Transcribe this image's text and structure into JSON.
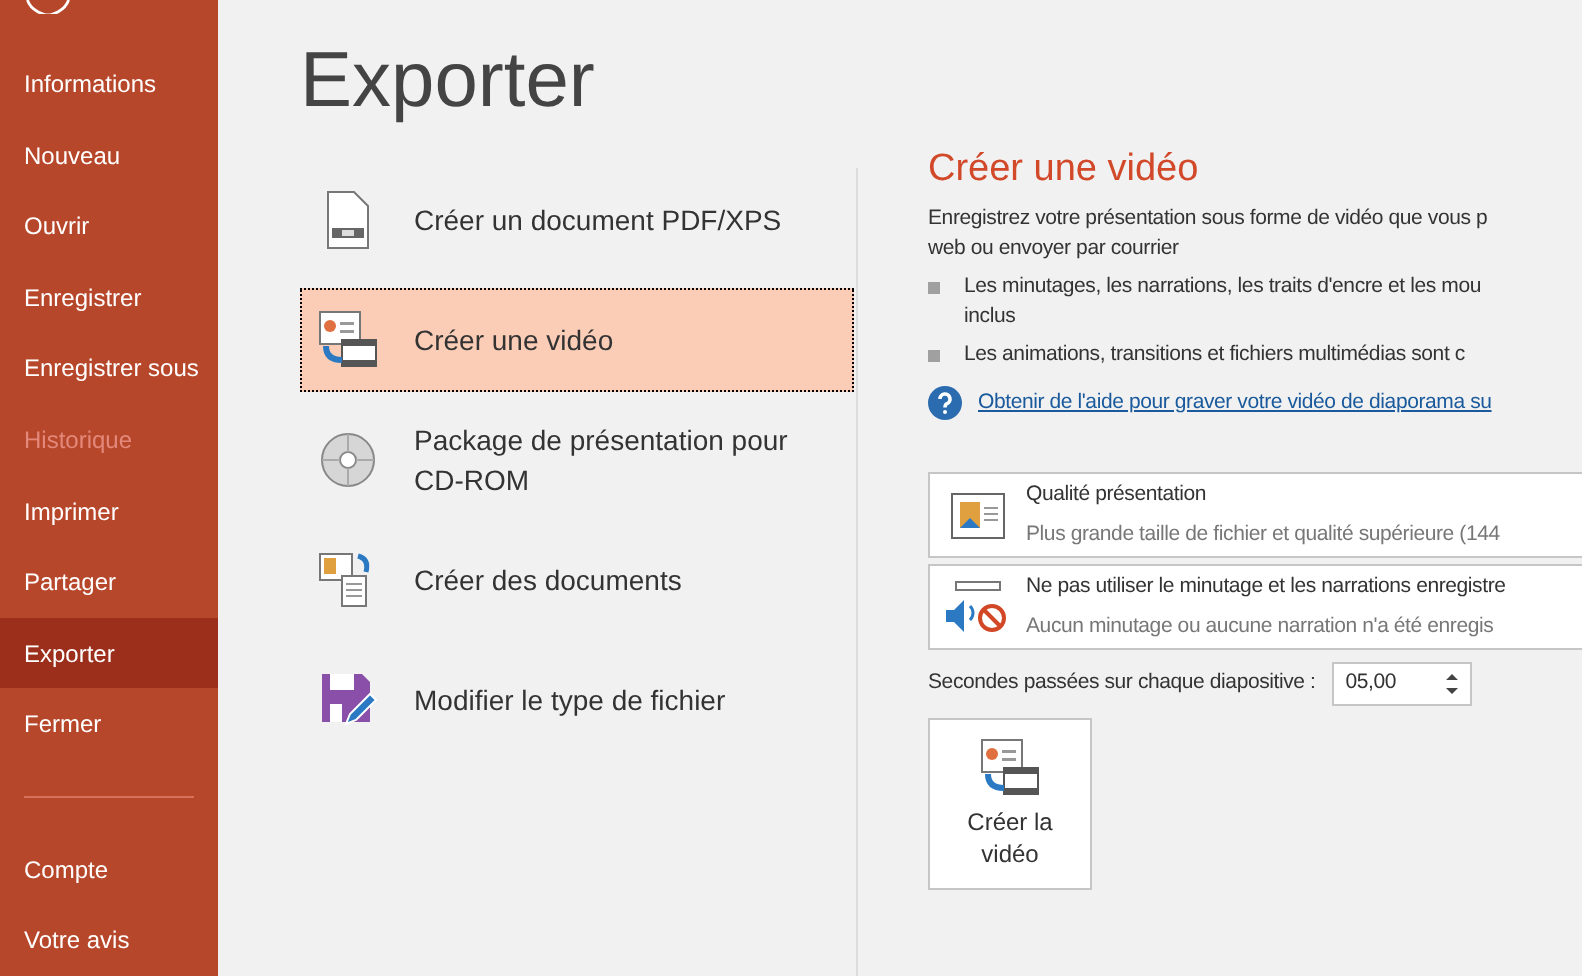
{
  "sidebar": {
    "items": [
      {
        "label": "Informations",
        "selected": false,
        "disabled": false
      },
      {
        "label": "Nouveau",
        "selected": false,
        "disabled": false
      },
      {
        "label": "Ouvrir",
        "selected": false,
        "disabled": false
      },
      {
        "label": "Enregistrer",
        "selected": false,
        "disabled": false
      },
      {
        "label": "Enregistrer sous",
        "selected": false,
        "disabled": false
      },
      {
        "label": "Historique",
        "selected": false,
        "disabled": true
      },
      {
        "label": "Imprimer",
        "selected": false,
        "disabled": false
      },
      {
        "label": "Partager",
        "selected": false,
        "disabled": false
      },
      {
        "label": "Exporter",
        "selected": true,
        "disabled": false
      },
      {
        "label": "Fermer",
        "selected": false,
        "disabled": false
      }
    ],
    "bottom_items": [
      {
        "label": "Compte",
        "selected": false,
        "disabled": false
      },
      {
        "label": "Votre avis",
        "selected": false,
        "disabled": false
      }
    ]
  },
  "page_title": "Exporter",
  "options": [
    {
      "kind": "pdf",
      "label": "Créer un document PDF/XPS",
      "selected": false
    },
    {
      "kind": "video",
      "label": "Créer une vidéo",
      "selected": true
    },
    {
      "kind": "cd",
      "label": "Package de présentation pour CD-ROM",
      "selected": false
    },
    {
      "kind": "handouts",
      "label": "Créer des documents",
      "selected": false
    },
    {
      "kind": "filetype",
      "label": "Modifier le type de fichier",
      "selected": false
    }
  ],
  "detail": {
    "title": "Créer une vidéo",
    "description_lines": [
      "Enregistrez votre présentation sous forme de vidéo que vous p",
      "web ou envoyer par courrier"
    ],
    "bullets": [
      {
        "lines": [
          "Les minutages, les narrations, les traits d'encre et les mou",
          "inclus"
        ]
      },
      {
        "lines": [
          "Les animations, transitions et fichiers multimédias sont c"
        ]
      }
    ],
    "help_link": "Obtenir de l'aide pour graver votre vidéo de diaporama su",
    "dropdowns": [
      {
        "kind": "quality",
        "title": "Qualité présentation",
        "subtitle": "Plus grande taille de fichier et qualité supérieure (144"
      },
      {
        "kind": "timing",
        "title": "Ne pas utiliser le minutage et les narrations enregistre",
        "subtitle": "Aucun minutage ou aucune narration n'a été enregis"
      }
    ],
    "seconds_label": "Secondes passées sur chaque diapositive :",
    "seconds_value": "05,00",
    "create_button": "Créer la vidéo"
  }
}
